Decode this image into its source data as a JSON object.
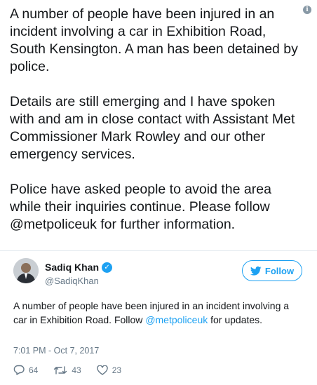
{
  "statement": {
    "text": "A number of people have been injured in an incident involving a car in Exhibition Road, South Kensington. A man has been detained by police.\n\nDetails are still emerging and I have spoken with and am in close contact with Assistant Met Commissioner Mark Rowley and our other emergency services.\n\nPolice have asked people to avoid the area while their inquiries continue. Please follow @metpoliceuk for further information."
  },
  "author": {
    "name": "Sadiq Khan",
    "handle": "@SadiqKhan"
  },
  "follow_label": "Follow",
  "tweet": {
    "text_before": "A number of people have been injured in an incident involving a car in Exhibition Road. Follow ",
    "mention": "@metpoliceuk",
    "text_after": " for updates."
  },
  "timestamp": "7:01 PM - Oct 7, 2017",
  "counts": {
    "replies": "64",
    "retweets": "43",
    "likes": "23"
  },
  "colors": {
    "brand": "#1da1f2",
    "text": "#14171a",
    "muted": "#657786"
  },
  "icons": {
    "info": "info-icon",
    "verified": "verified-badge-icon",
    "follow": "twitter-bird-icon",
    "reply": "reply-icon",
    "retweet": "retweet-icon",
    "like": "heart-icon"
  }
}
